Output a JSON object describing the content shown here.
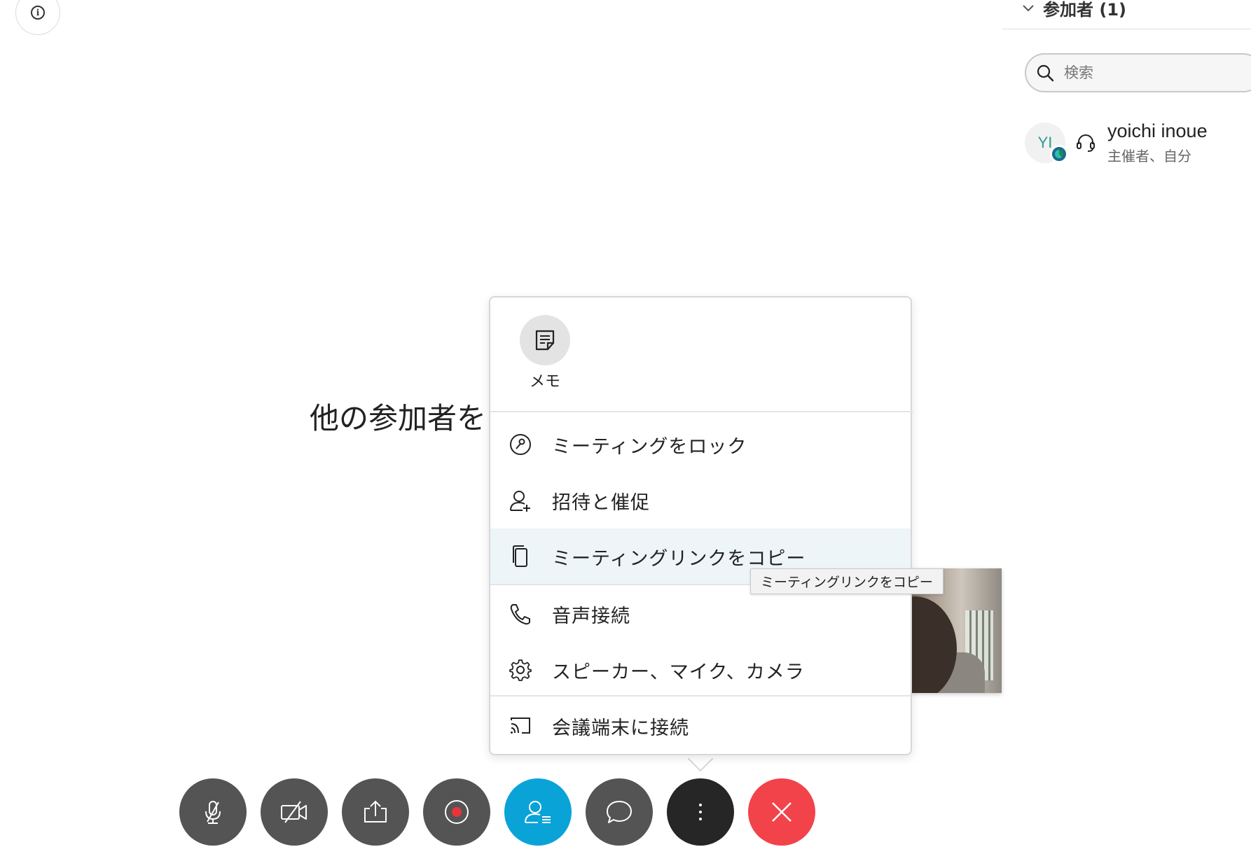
{
  "info_button": {
    "icon": "info-icon",
    "glyph": "i"
  },
  "participants_panel": {
    "title": "参加者 (1)",
    "search": {
      "placeholder": "検索",
      "value": ""
    },
    "participants": [
      {
        "initials": "YI",
        "name": "yoichi inoue",
        "role": "主催者、自分",
        "status_icon": "headset-icon"
      }
    ]
  },
  "stage": {
    "waiting_text": "他の参加者を"
  },
  "more_menu": {
    "memo": {
      "label": "メモ",
      "icon": "note-icon"
    },
    "items": [
      {
        "label": "ミーティングをロック",
        "icon": "lock-icon"
      },
      {
        "label": "招待と催促",
        "icon": "add-person-icon"
      },
      {
        "label": "ミーティングリンクをコピー",
        "icon": "copy-icon",
        "highlighted": true
      },
      {
        "label": "音声接続",
        "icon": "phone-icon"
      },
      {
        "label": "スピーカー、マイク、カメラ",
        "icon": "gear-icon"
      },
      {
        "label": "会議端末に接続",
        "icon": "cast-icon"
      }
    ]
  },
  "tooltip": {
    "text": "ミーティングリンクをコピー"
  },
  "controls": [
    {
      "name": "mute-button",
      "icon": "microphone-muted-icon"
    },
    {
      "name": "video-button",
      "icon": "video-off-icon"
    },
    {
      "name": "share-button",
      "icon": "share-icon"
    },
    {
      "name": "record-button",
      "icon": "record-icon"
    },
    {
      "name": "participants-button",
      "icon": "participants-icon",
      "active": true
    },
    {
      "name": "chat-button",
      "icon": "chat-icon"
    },
    {
      "name": "more-button",
      "icon": "more-options-icon"
    },
    {
      "name": "leave-button",
      "icon": "close-icon"
    }
  ],
  "colors": {
    "accent_blue": "#0aa3d8",
    "leave_red": "#f2434a",
    "control_gray": "#545454",
    "record_red": "#e8343b",
    "menu_highlight": "#eef5f9"
  }
}
